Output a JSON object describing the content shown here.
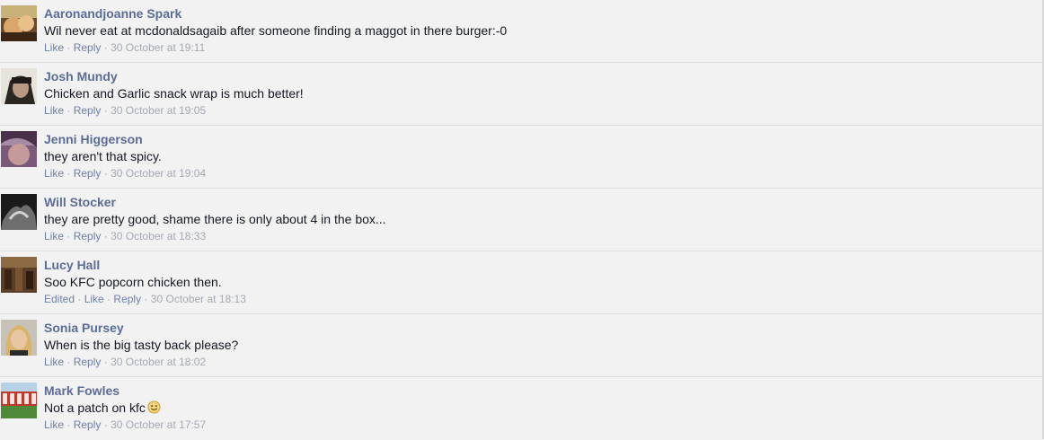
{
  "comments": [
    {
      "author": "Aaronandjoanne Spark",
      "text": "Wil never eat at mcdonaldsagaib after someone finding a maggot in there burger:-0",
      "like": "Like",
      "reply": "Reply",
      "timestamp": "30 October at 19:11"
    },
    {
      "author": "Josh Mundy",
      "text": "Chicken and Garlic snack wrap is much better!",
      "like": "Like",
      "reply": "Reply",
      "timestamp": "30 October at 19:05"
    },
    {
      "author": "Jenni Higgerson",
      "text": "they aren't that spicy.",
      "like": "Like",
      "reply": "Reply",
      "timestamp": "30 October at 19:04"
    },
    {
      "author": "Will Stocker",
      "text": "they are pretty good, shame there is only about 4 in the box...",
      "like": "Like",
      "reply": "Reply",
      "timestamp": "30 October at 18:33"
    },
    {
      "author": "Lucy Hall",
      "text": "Soo KFC popcorn chicken then.",
      "edited": "Edited",
      "like": "Like",
      "reply": "Reply",
      "timestamp": "30 October at 18:13"
    },
    {
      "author": "Sonia Pursey",
      "text": "When is the big tasty back please?",
      "like": "Like",
      "reply": "Reply",
      "timestamp": "30 October at 18:02"
    },
    {
      "author": "Mark Fowles",
      "text": "Not a patch on kfc",
      "emoji": "smiley-emoji",
      "like": "Like",
      "reply": "Reply",
      "timestamp": "30 October at 17:57"
    }
  ],
  "separator": "·",
  "colors": {
    "background": "#f2f2f2",
    "author_name": "#5b6c96",
    "body_text": "#141823",
    "action_link": "#6d7fa6",
    "timestamp": "#a3a9b5",
    "divider": "#dddfe2"
  }
}
